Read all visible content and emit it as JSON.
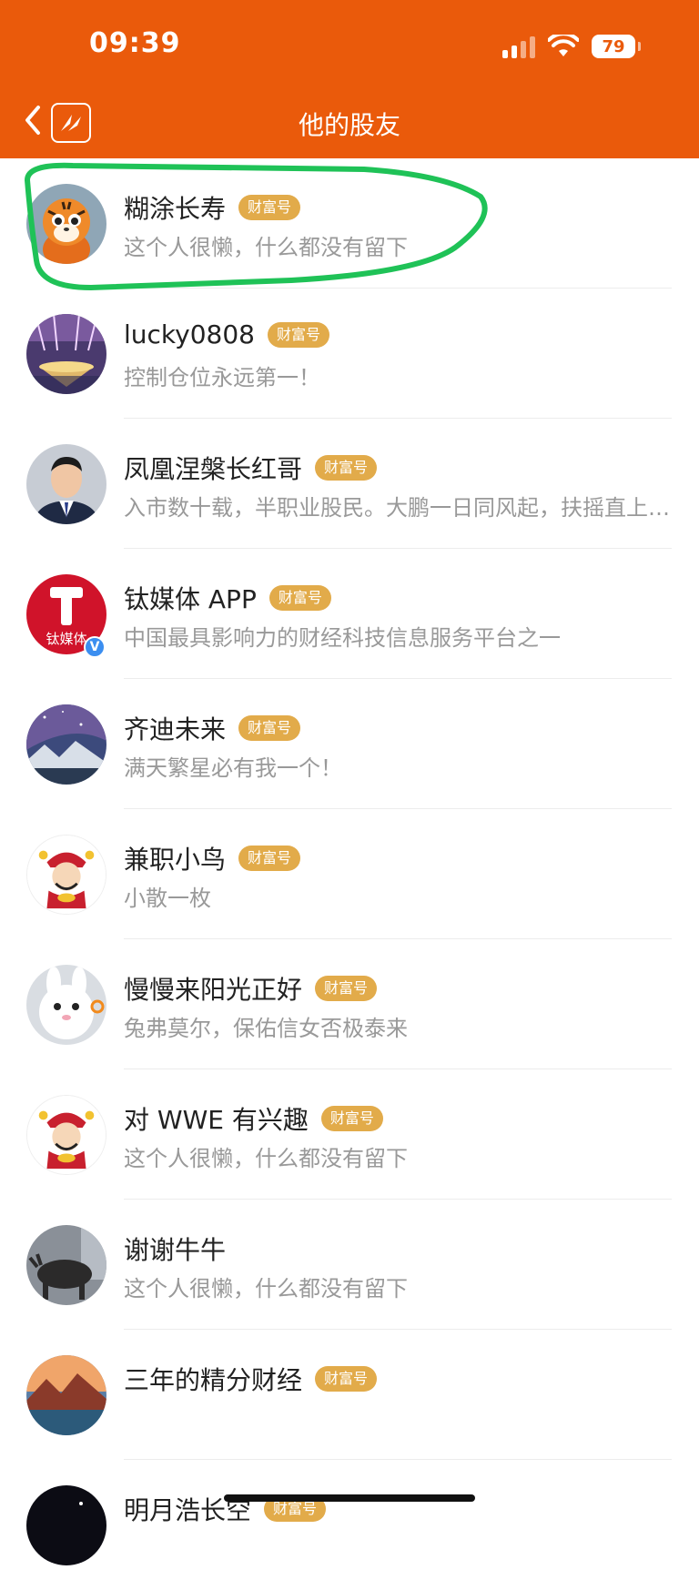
{
  "status_bar": {
    "time": "09:39",
    "battery": "79"
  },
  "header": {
    "title": "他的股友"
  },
  "friends": [
    {
      "name": "糊涂长寿",
      "badge": "财富号",
      "bio": "这个人很懒，什么都没有留下",
      "avatar": "tiger-avatar"
    },
    {
      "name": "lucky0808",
      "badge": "财富号",
      "bio": "控制仓位永远第一！",
      "avatar": "chandelier-avatar"
    },
    {
      "name": "凤凰涅槃长红哥",
      "badge": "财富号",
      "bio": "入市数十载，半职业股民。大鹏一日同风起，扶摇直上九万里",
      "avatar": "businessman-avatar"
    },
    {
      "name": "钛媒体 APP",
      "badge": "财富号",
      "bio": "中国最具影响力的财经科技信息服务平台之一",
      "avatar": "tmtpost-logo-avatar",
      "logo_text": "钛媒体",
      "verified": "V"
    },
    {
      "name": "齐迪未来",
      "badge": "财富号",
      "bio": "满天繁星必有我一个！",
      "avatar": "starry-mountain-avatar"
    },
    {
      "name": "兼职小鸟",
      "badge": "财富号",
      "bio": "小散一枚",
      "avatar": "fortune-god-avatar"
    },
    {
      "name": "慢慢来阳光正好",
      "badge": "财富号",
      "bio": "兔弗莫尔，保佑信女否极泰来",
      "avatar": "white-bunny-avatar"
    },
    {
      "name": "对 WWE 有兴趣",
      "badge": "财富号",
      "bio": "这个人很懒，什么都没有留下",
      "avatar": "fortune-god-avatar"
    },
    {
      "name": "谢谢牛牛",
      "badge": "",
      "bio": "这个人很懒，什么都没有留下",
      "avatar": "bull-statue-avatar"
    },
    {
      "name": "三年的精分财经",
      "badge": "财富号",
      "bio": "",
      "avatar": "mountain-sunset-avatar"
    },
    {
      "name": "明月浩长空",
      "badge": "财富号",
      "bio": "",
      "avatar": "night-sky-avatar"
    }
  ],
  "colors": {
    "brand": "#ea5a0b",
    "badge": "#e2ab4a",
    "highlight": "#1fc257"
  }
}
